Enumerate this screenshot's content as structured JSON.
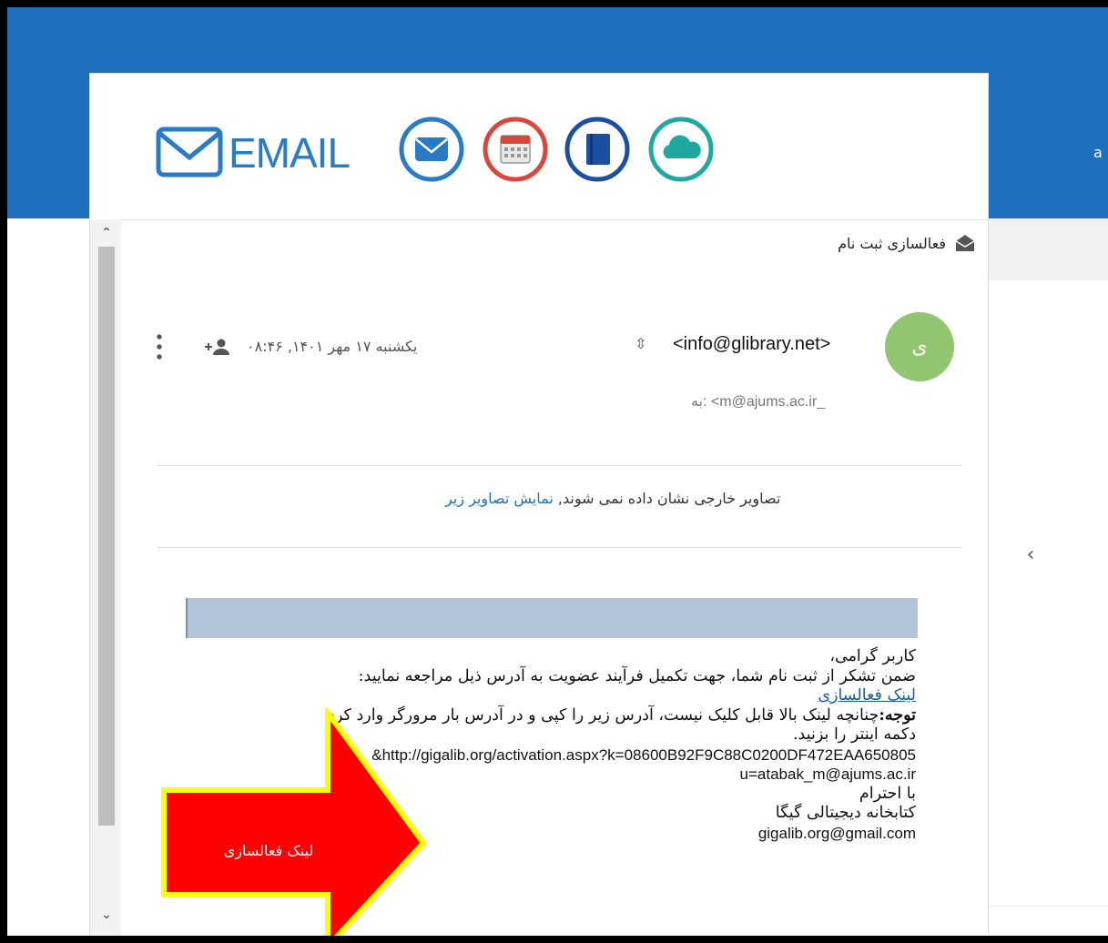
{
  "page": {
    "topbar_edge_text": "a"
  },
  "logo": {
    "text": "EMAIL"
  },
  "app_icons": [
    "mail-icon",
    "calendar-icon",
    "notebook-icon",
    "cloud-icon"
  ],
  "message": {
    "subject": "فعالسازی ثبت نام",
    "sender_avatar_initial": "ی",
    "sender_email": "<info@glibrary.net>",
    "recipient": "به: <m@ajums.ac.ir_",
    "date": "یکشنبه ۱۷ مهر ۱۴۰۱, ۰۸:۴۶"
  },
  "images_notice": {
    "text": "تصاویر خارجی نشان داده نمی شوند,",
    "link": "نمایش تصاویر زیر"
  },
  "body": {
    "greeting": "کاربر گرامی،",
    "line1": "ضمن تشکر از ثبت نام شما، جهت تکمیل فرآیند عضویت به آدرس ذیل مراجعه نمایید:",
    "activation_link": "لینک فعالسازی",
    "note_label": "توجه:",
    "note_text": "چنانچه لینک بالا قابل کلیک نیست، آدرس زیر را کپی و در آدرس بار مرورگر وارد کرد",
    "note_text2": "دکمه اینتر را بزنید.",
    "url_line1": "http://gigalib.org/activation.aspx?k=08600B92F9C88C0200DF472EAA650805&",
    "url_line2": "u=atabak_m@ajums.ac.ir",
    "regards": "با احترام",
    "signature": "کتابخانه دیجیتالی گیگا",
    "signature_email": "gigalib.org@gmail.com"
  },
  "annotation": {
    "label": "لینک فعالسازی"
  },
  "colors": {
    "topbar": "#1f6fbf",
    "avatar": "#92c56f",
    "arrow_fill": "#ff0000",
    "arrow_border": "#ffff00"
  }
}
